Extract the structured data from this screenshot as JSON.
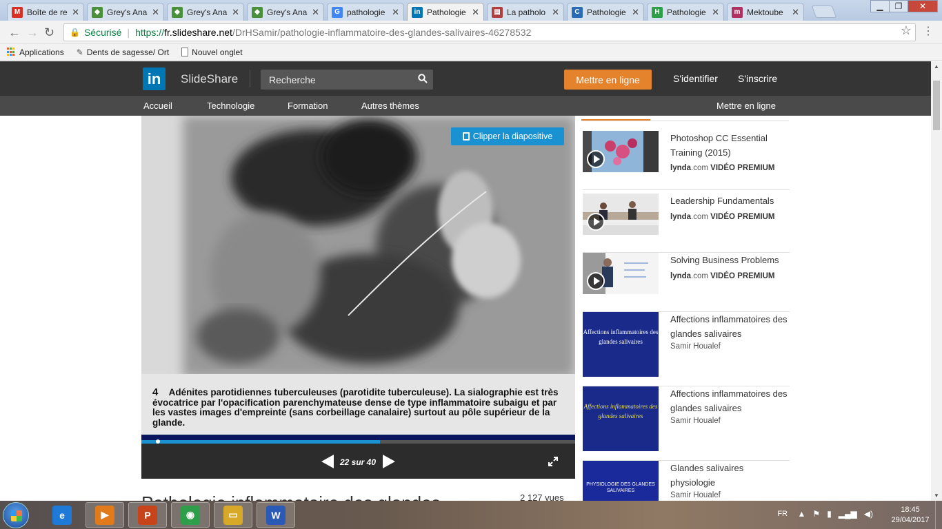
{
  "browser": {
    "tabs": [
      {
        "label": "Boîte de re",
        "icon": "gmail-icon",
        "color": "#d93025",
        "glyph": "M"
      },
      {
        "label": "Grey's Ana",
        "icon": "chrome-ext-icon",
        "color": "#4a8f3a",
        "glyph": "◆"
      },
      {
        "label": "Grey's Ana",
        "icon": "chrome-ext-icon",
        "color": "#4a8f3a",
        "glyph": "◆"
      },
      {
        "label": "Grey's Ana",
        "icon": "chrome-ext-icon",
        "color": "#4a8f3a",
        "glyph": "◆"
      },
      {
        "label": "pathologie",
        "icon": "google-icon",
        "color": "#4285f4",
        "glyph": "G"
      },
      {
        "label": "Pathologie",
        "icon": "linkedin-icon",
        "color": "#0077b5",
        "glyph": "in"
      },
      {
        "label": "La patholo",
        "icon": "doc-icon",
        "color": "#b04040",
        "glyph": "▤"
      },
      {
        "label": "Pathologie",
        "icon": "chu-icon",
        "color": "#2a6bb5",
        "glyph": "C"
      },
      {
        "label": "Pathologie",
        "icon": "h-icon",
        "color": "#2e9e4a",
        "glyph": "H"
      },
      {
        "label": "Mektoube",
        "icon": "mektoube-icon",
        "color": "#b03060",
        "glyph": "m"
      }
    ],
    "active_tab": 5,
    "address": {
      "secure_label": "Sécurisé",
      "protocol": "https://",
      "host": "fr.slideshare.net",
      "path": "/DrHSamir/pathologie-inflammatoire-des-glandes-salivaires-46278532"
    },
    "bookmarks": [
      {
        "label": "Applications",
        "icon": "apps-grid-icon"
      },
      {
        "label": "Dents de sagesse/ Ort",
        "icon": "tooth-icon"
      },
      {
        "label": "Nouvel onglet",
        "icon": "page-icon"
      }
    ]
  },
  "header": {
    "brand": "SlideShare",
    "search_placeholder": "Recherche",
    "upload": "Mettre en ligne",
    "login": "S'identifier",
    "signup": "S'inscrire"
  },
  "nav": {
    "items": [
      "Accueil",
      "Technologie",
      "Formation",
      "Autres thèmes"
    ],
    "right": "Mettre en ligne"
  },
  "player": {
    "clip_label": "Clipper la diapositive",
    "caption_number": "4",
    "caption_text": "Adénites parotidiennes tuberculeuses (parotidite tuberculeuse). La sialographie est très évocatrice par l'opacification parenchymateuse dense de type inflammatoire subaigu et par les vastes images d'empreinte (sans corbeillage canalaire) surtout au pôle supérieur de la glande.",
    "counter": "22 sur 40",
    "current": 22,
    "total": 40,
    "progress": 0.55
  },
  "below": {
    "title": "Pathologie inflammatoire des glandes",
    "views": "2 127 vues"
  },
  "recommendations": [
    {
      "title": "Photoshop CC Essential Training (2015)",
      "source": "lynda",
      "source_suffix": ".com",
      "badge": "VIDÉO PREMIUM",
      "kind": "video"
    },
    {
      "title": "Leadership Fundamentals",
      "source": "lynda",
      "source_suffix": ".com",
      "badge": "VIDÉO PREMIUM",
      "kind": "video"
    },
    {
      "title": "Solving Business Problems",
      "source": "lynda",
      "source_suffix": ".com",
      "badge": "VIDÉO PREMIUM",
      "kind": "video"
    },
    {
      "title": "Affections inflammatoires des glandes salivaires",
      "author": "Samir Houalef",
      "thumb_text": "Affections inflammatoires des glandes salivaires",
      "kind": "slide"
    },
    {
      "title": "Affections inflammatoires des glandes salivaires",
      "author": "Samir Houalef",
      "thumb_text": "Affections inflammatoires des glandes salivaires",
      "kind": "slide"
    },
    {
      "title": "Glandes salivaires physiologie",
      "author": "Samir Houalef",
      "thumb_text": "PHYSIOLOGIE DES GLANDES SALIVAIRES",
      "kind": "slide"
    }
  ],
  "taskbar": {
    "apps": [
      {
        "name": "internet-explorer-icon",
        "glyph": "e",
        "color": "#1e7ad6"
      },
      {
        "name": "media-player-icon",
        "glyph": "▶",
        "color": "#e07a1a"
      },
      {
        "name": "powerpoint-app-icon",
        "glyph": "P",
        "color": "#c7431a"
      },
      {
        "name": "chrome-icon",
        "glyph": "◉",
        "color": "#2e9e4a"
      },
      {
        "name": "file-explorer-icon",
        "glyph": "▭",
        "color": "#d8a828"
      },
      {
        "name": "word-icon",
        "glyph": "W",
        "color": "#2a5ab5"
      }
    ],
    "language": "FR",
    "time": "18:45",
    "date": "29/04/2017"
  }
}
